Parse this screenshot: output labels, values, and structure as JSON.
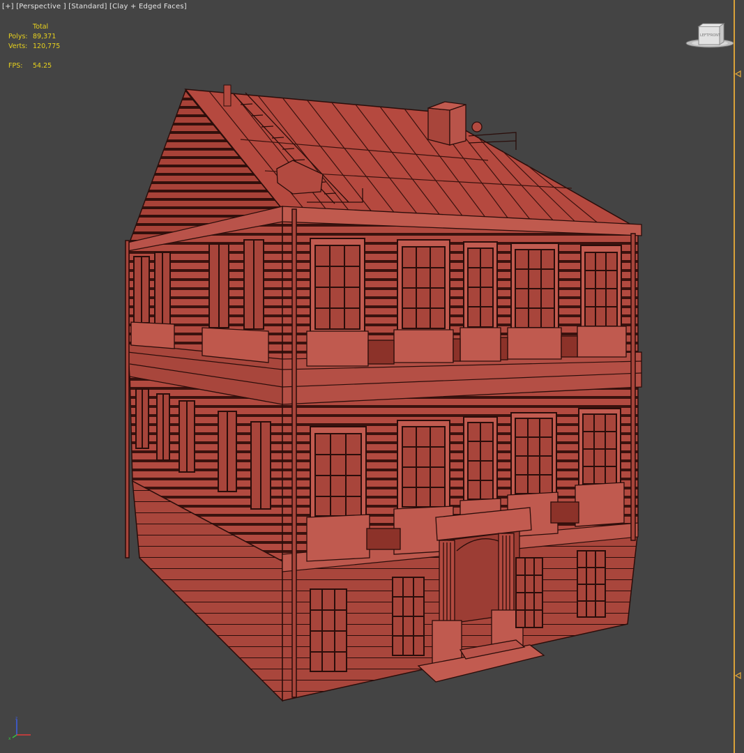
{
  "viewport": {
    "label_plus": "[+]",
    "label_view": "[Perspective ]",
    "label_shading": "[Standard]",
    "label_style": "[Clay + Edged Faces]"
  },
  "stats": {
    "total_header": "Total",
    "polys_label": "Polys:",
    "polys_value": "89,371",
    "verts_label": "Verts:",
    "verts_value": "120,775",
    "fps_label": "FPS:",
    "fps_value": "54.25"
  },
  "viewcube": {
    "face_left": "LEFT",
    "face_front": "FRONT"
  },
  "colors": {
    "background": "#444444",
    "clay": "#b24a40",
    "edges": "#2a0d0a",
    "stats_text": "#e8d21d",
    "active_border": "#d9a13a"
  },
  "icons": [
    "viewcube-icon",
    "axis-gizmo-icon",
    "time-slider-marker-icon"
  ]
}
